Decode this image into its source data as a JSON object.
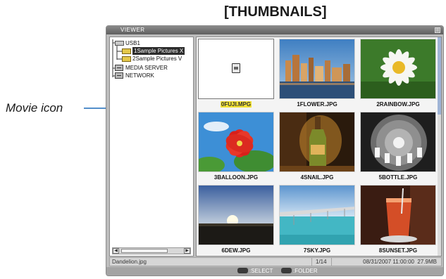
{
  "page": {
    "heading": "[THUMBNAILS]",
    "callout_label": "Movie icon"
  },
  "window": {
    "title": "VIEWER"
  },
  "tree": {
    "items": [
      {
        "label": "USB1",
        "icon": "usb-drive-icon",
        "level": 0,
        "selected": false
      },
      {
        "label": "1Sample Pictures X",
        "icon": "folder-icon",
        "level": 1,
        "selected": true
      },
      {
        "label": "2Sample Pictures V",
        "icon": "folder-icon",
        "level": 1,
        "selected": false
      },
      {
        "label": "MEDIA SERVER",
        "icon": "media-server-icon",
        "level": 0,
        "selected": false
      },
      {
        "label": "NETWORK",
        "icon": "network-icon",
        "level": 0,
        "selected": false
      }
    ]
  },
  "thumbnails": [
    {
      "name": "0FUJI.MPG",
      "type": "movie",
      "highlighted": true
    },
    {
      "name": "1FLOWER.JPG",
      "type": "image",
      "highlighted": false
    },
    {
      "name": "2RAINBOW.JPG",
      "type": "image",
      "highlighted": false
    },
    {
      "name": "3BALLOON.JPG",
      "type": "image",
      "highlighted": false
    },
    {
      "name": "4SNAIL.JPG",
      "type": "image",
      "highlighted": false
    },
    {
      "name": "5BOTTLE.JPG",
      "type": "image",
      "highlighted": false
    },
    {
      "name": "6DEW.JPG",
      "type": "image",
      "highlighted": false
    },
    {
      "name": "7SKY.JPG",
      "type": "image",
      "highlighted": false
    },
    {
      "name": "8SUNSET.JPG",
      "type": "image",
      "highlighted": false
    }
  ],
  "status": {
    "filename": "Dandelion.jpg",
    "counter": "1/14",
    "datetime": "08/31/2007 11:00:00",
    "filesize": "27.9MB"
  },
  "hints": {
    "select_label": ":SELECT",
    "folder_label": ":FOLDER"
  },
  "colors": {
    "highlight_caption": "#f2e233",
    "tree_selected": "#2b2b2b",
    "title_bar": "#6f6f6f"
  }
}
